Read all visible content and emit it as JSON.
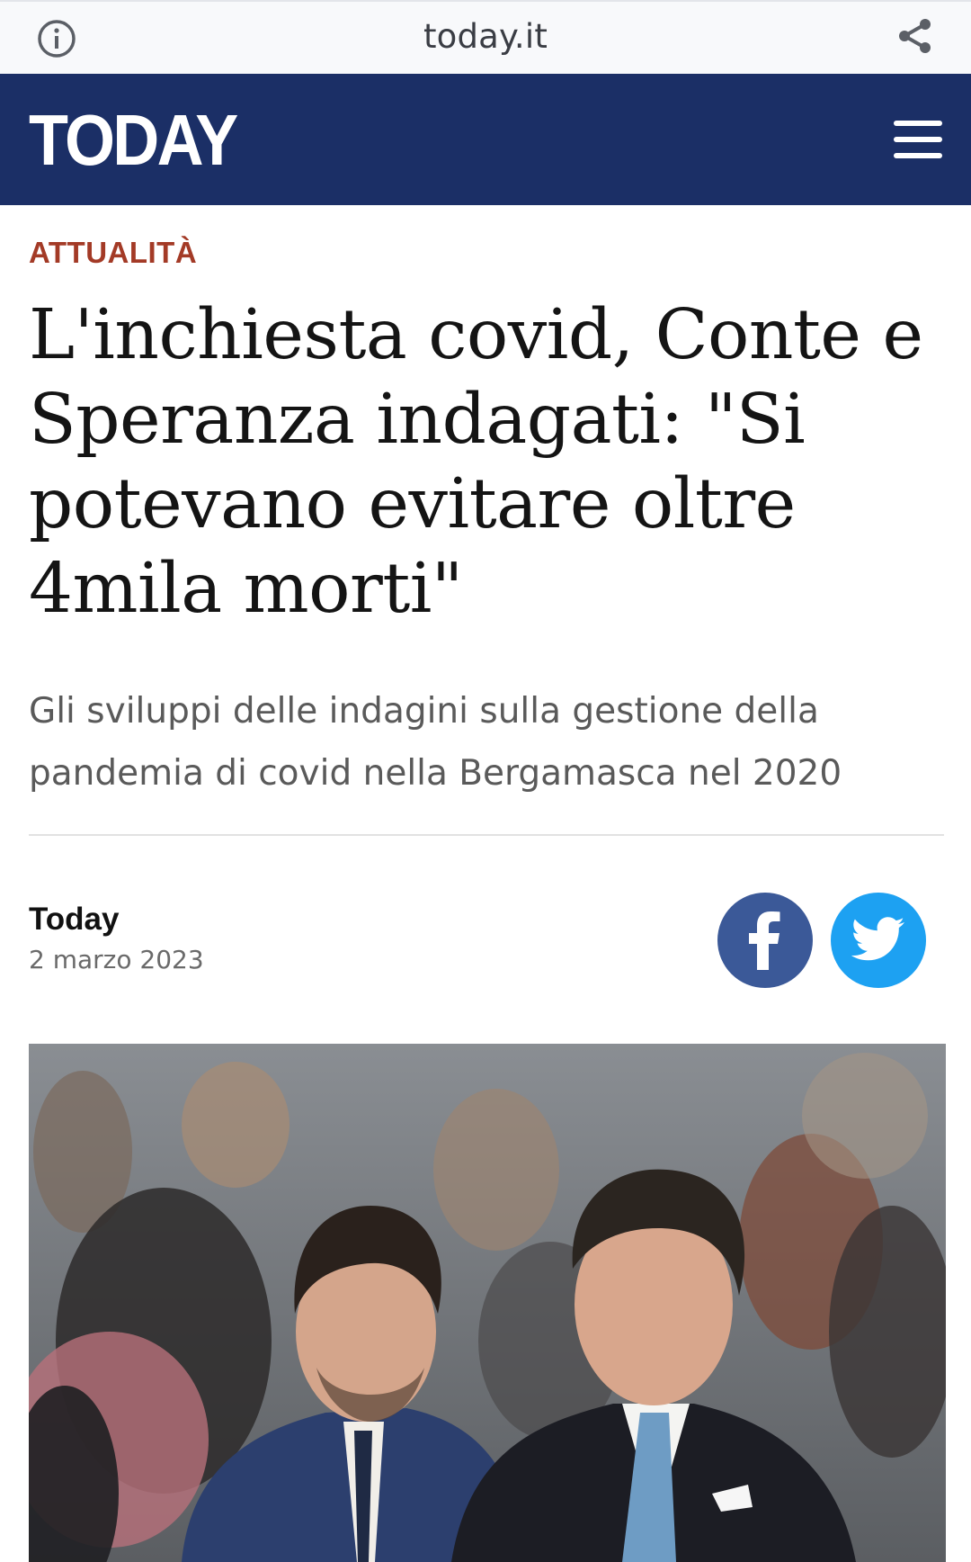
{
  "browser": {
    "url": "today.it",
    "info_icon": "info-icon",
    "share_icon": "share-icon"
  },
  "header": {
    "logo": "TODAY",
    "menu_icon": "hamburger-menu-icon",
    "background_color": "#1b2f66"
  },
  "article": {
    "category": "ATTUALITÀ",
    "headline": "L'inchiesta covid, Conte e Speranza indagati: \"Si potevano evitare oltre 4mila morti\"",
    "subtitle": "Gli sviluppi delle indagini sulla gestione della pandemia di covid nella Bergamasca nel 2020",
    "author": "Today",
    "date": "2 marzo 2023",
    "category_color": "#a33a26"
  },
  "share": {
    "facebook_icon": "facebook-icon",
    "twitter_icon": "twitter-icon",
    "facebook_color": "#3b5998",
    "twitter_color": "#1da1f2"
  },
  "photo": {
    "description_icon": "article-photo"
  }
}
